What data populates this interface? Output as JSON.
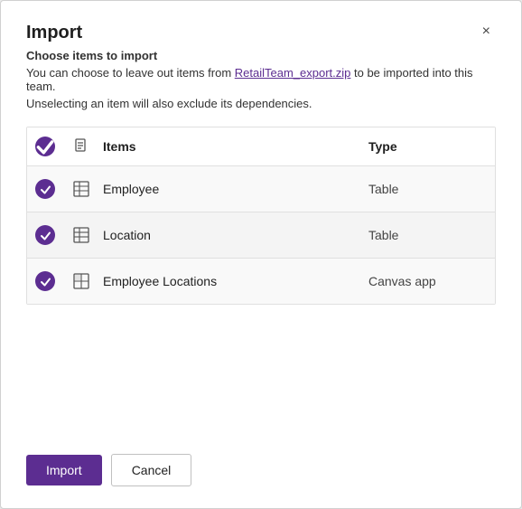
{
  "dialog": {
    "title": "Import",
    "close_label": "×",
    "subtitle_prefix": "Choose items to import",
    "subtitle_text": "You can choose to leave out items from ",
    "subtitle_link": "RetailTeam_export.zip",
    "subtitle_suffix": " to be imported into this team.",
    "subtitle2": "Unselecting an item will also exclude its dependencies.",
    "table": {
      "col_items_header": "Items",
      "col_type_header": "Type",
      "rows": [
        {
          "name": "Employee",
          "type": "Table",
          "checked": true
        },
        {
          "name": "Location",
          "type": "Table",
          "checked": true
        },
        {
          "name": "Employee Locations",
          "type": "Canvas app",
          "checked": true
        }
      ]
    },
    "footer": {
      "import_label": "Import",
      "cancel_label": "Cancel"
    }
  }
}
